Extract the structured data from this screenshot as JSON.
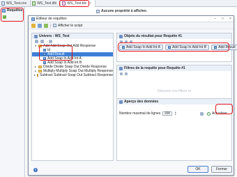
{
  "tabs": [
    {
      "label": "WS_Test.cnx",
      "active": false
    },
    {
      "label": "WS_Test.dfx",
      "active": false
    },
    {
      "label": "WS_Test.blx",
      "active": true
    }
  ],
  "left_pane": {
    "title": "Requêtes"
  },
  "behind": {
    "message": "Aucune propriété à afficher."
  },
  "dialog": {
    "title": "Editeur de requêtes",
    "toolbar": {
      "script_label": "Afficher le script"
    },
    "universe": {
      "header": "Univers : WS_Test",
      "tree": [
        {
          "label": "Add Add Soap Out Add Response",
          "level": 0,
          "type": "folder",
          "expanded": true
        },
        {
          "label": "Id",
          "level": 1,
          "type": "attr"
        },
        {
          "label": "Add Result",
          "level": 1,
          "type": "attr",
          "selected": true
        },
        {
          "label": "Add Soap In Add Int A",
          "level": 1,
          "type": "attr"
        },
        {
          "label": "Add Soap In Add Int B",
          "level": 1,
          "type": "attr"
        },
        {
          "label": "Divide Divide Soap Out Divide Response",
          "level": 0,
          "type": "folder",
          "expanded": false
        },
        {
          "label": "Multiply Multiply Soap Out Multiply Response",
          "level": 0,
          "type": "folder",
          "expanded": false
        },
        {
          "label": "Subtract Subtract Soap Out Subtract Response",
          "level": 0,
          "type": "folder",
          "expanded": false
        }
      ]
    },
    "result_objects": {
      "header": "Objets du résultat pour Requête #1",
      "chips": [
        "Add Soap In Add Int A",
        "Add Soap In Add Int B",
        "Add Result"
      ]
    },
    "filters": {
      "header": "Filtres de la requête pour Requête #1",
      "drop_hint": "Déposez vos filtres ici"
    },
    "preview": {
      "header": "Aperçu des données",
      "rows_label": "Nombre maximal de lignes",
      "rows_value": "200",
      "refresh_label": "Actualiser"
    },
    "buttons": {
      "help": "?",
      "ok": "OK",
      "close": "Fermer"
    }
  }
}
